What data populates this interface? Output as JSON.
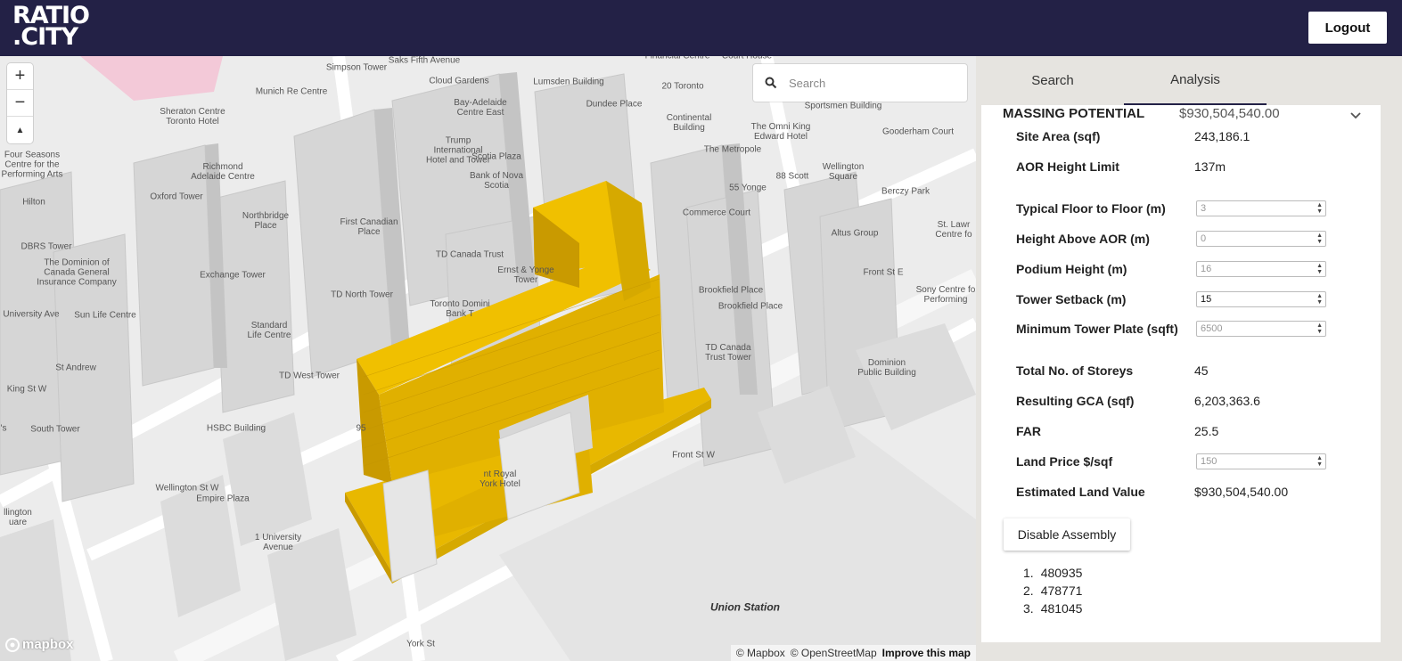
{
  "header": {
    "logo_line1": "RATIO",
    "logo_line2": ".CITY",
    "logout_label": "Logout"
  },
  "map": {
    "search_placeholder": "Search",
    "zoom_in": "+",
    "zoom_out": "−",
    "compass": "▲",
    "mapbox_logo": "mapbox",
    "attribution": [
      "© Mapbox",
      "© OpenStreetMap"
    ],
    "improve_link": "Improve this map",
    "labels": [
      {
        "text": "Simpson Tower"
      },
      {
        "text": "Saks Fifth Avenue"
      },
      {
        "text": "Financial Centre"
      },
      {
        "text": "Court House"
      },
      {
        "text": "Cloud Gardens"
      },
      {
        "text": "Lumsden Building"
      },
      {
        "text": "Munich Re Centre"
      },
      {
        "text": "20 Toronto"
      },
      {
        "text": "Sportsmen Building"
      },
      {
        "text": "Bay-Adelaide\nCentre East"
      },
      {
        "text": "Dundee Place"
      },
      {
        "text": "Sheraton Centre\nToronto Hotel"
      },
      {
        "text": "Continental\nBuilding"
      },
      {
        "text": "The Omni King\nEdward Hotel"
      },
      {
        "text": "Gooderham Court"
      },
      {
        "text": "Trump\nInternational\nHotel and Tower"
      },
      {
        "text": "Scotia Plaza"
      },
      {
        "text": "The Metropole"
      },
      {
        "text": "Four Seasons\nCentre for the\nPerforming Arts"
      },
      {
        "text": "Richmond\nAdelaide Centre"
      },
      {
        "text": "Bank of Nova\nScotia"
      },
      {
        "text": "88 Scott"
      },
      {
        "text": "Wellington\nSquare"
      },
      {
        "text": "55 Yonge"
      },
      {
        "text": "Berczy Park"
      },
      {
        "text": "Oxford Tower"
      },
      {
        "text": "Hilton"
      },
      {
        "text": "Commerce Court"
      },
      {
        "text": "Northbridge\nPlace"
      },
      {
        "text": "First Canadian\nPlace"
      },
      {
        "text": "St. Lawr\nCentre fo"
      },
      {
        "text": "Altus Group"
      },
      {
        "text": "DBRS Tower"
      },
      {
        "text": "TD Canada Trust"
      },
      {
        "text": "The Dominion of\nCanada General\nInsurance Company"
      },
      {
        "text": "Exchange Tower"
      },
      {
        "text": "Ernst & Yonge\nTower"
      },
      {
        "text": "Brookfield Place"
      },
      {
        "text": "Sony Centre fo\nPerforming"
      },
      {
        "text": "TD North Tower"
      },
      {
        "text": "Brookfield Place"
      },
      {
        "text": "Toronto Domini\nBank T"
      },
      {
        "text": "Sun Life Centre"
      },
      {
        "text": "Standard\nLife Centre"
      },
      {
        "text": "TD Canada\nTrust Tower"
      },
      {
        "text": "Dominion\nPublic Building"
      },
      {
        "text": "TD West Tower"
      },
      {
        "text": "South Tower"
      },
      {
        "text": "HSBC Building"
      },
      {
        "text": "95"
      },
      {
        "text": "nt Royal\nYork Hotel"
      },
      {
        "text": "Empire Plaza"
      },
      {
        "text": "llington\nuare"
      },
      {
        "text": "1 University\nAvenue"
      },
      {
        "text": "Union Station"
      },
      {
        "text": "Front St W"
      },
      {
        "text": "King St W"
      },
      {
        "text": "Wellington St W"
      },
      {
        "text": "University Ave"
      },
      {
        "text": "St Andrew"
      },
      {
        "text": "Front St E"
      },
      {
        "text": "York St"
      },
      {
        "text": "'s"
      }
    ]
  },
  "panel": {
    "tabs": [
      "Search",
      "Analysis"
    ],
    "active_tab": "Analysis",
    "section_title": "MASSING POTENTIAL",
    "section_value": "$930,504,540.00",
    "rows": {
      "site_area_label": "Site Area (sqf)",
      "site_area_value": "243,186.1",
      "aor_label": "AOR Height Limit",
      "aor_value": "137m",
      "floor_label": "Typical Floor to Floor (m)",
      "floor_value": "3",
      "height_above_label": "Height Above AOR (m)",
      "height_above_value": "0",
      "podium_label": "Podium Height (m)",
      "podium_value": "16",
      "setback_label": "Tower Setback (m)",
      "setback_value": "15",
      "min_plate_label": "Minimum Tower Plate (sqft)",
      "min_plate_value": "6500",
      "storeys_label": "Total No. of Storeys",
      "storeys_value": "45",
      "gca_label": "Resulting GCA (sqf)",
      "gca_value": "6,203,363.6",
      "far_label": "FAR",
      "far_value": "25.5",
      "land_price_label": "Land Price $/sqf",
      "land_price_value": "150",
      "land_value_label": "Estimated Land Value",
      "land_value_value": "$930,504,540.00"
    },
    "disable_button": "Disable Assembly",
    "parcels": [
      {
        "num": "1.",
        "id": "480935"
      },
      {
        "num": "2.",
        "id": "478771"
      },
      {
        "num": "3.",
        "id": "481045"
      }
    ]
  },
  "colors": {
    "header_bg": "#232146",
    "massing": "#e8b800",
    "massing_dark": "#c99a00",
    "buildings": "#d4d4d4",
    "map_bg": "#eeeeee"
  }
}
